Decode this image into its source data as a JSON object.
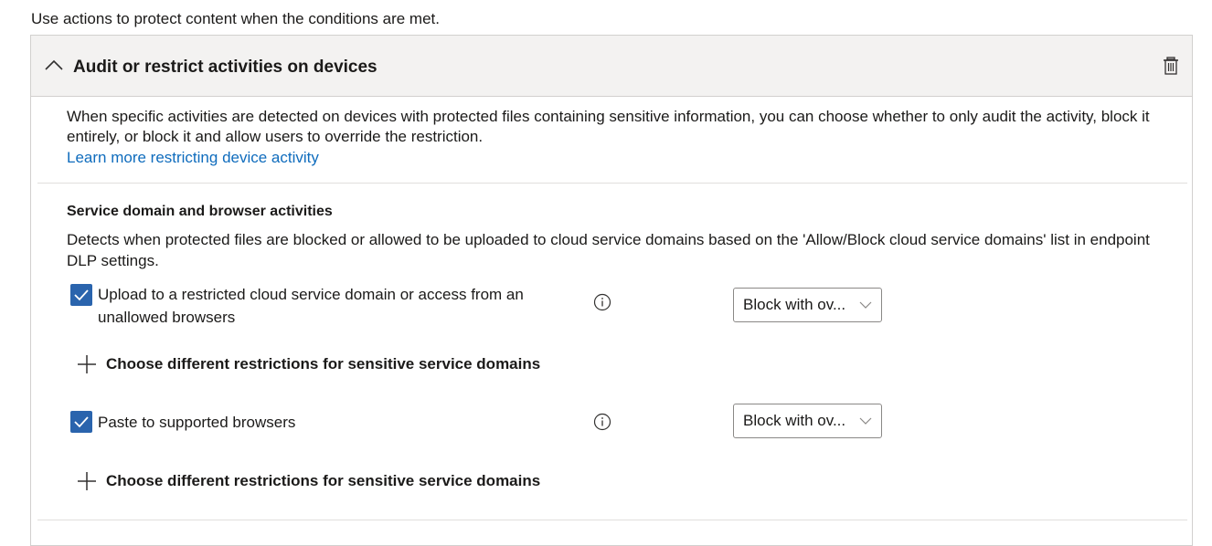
{
  "intro_text": "Use actions to protect content when the conditions are met.",
  "panel": {
    "title": "Audit or restrict activities on devices",
    "description": "When specific activities are detected on devices with protected files containing sensitive information, you can choose whether to only audit the activity, block it entirely, or block it and allow users to override the restriction.",
    "learn_more": "Learn more restricting device activity"
  },
  "section": {
    "title": "Service domain and browser activities",
    "description": "Detects when protected files are blocked or allowed to be uploaded to cloud service domains based on the 'Allow/Block cloud service domains' list in endpoint DLP settings.",
    "activities": [
      {
        "label": "Upload to a restricted cloud service domain or access from an unallowed browsers",
        "checked": true,
        "action": "Block with ov...",
        "add_link": "Choose different restrictions for sensitive service domains"
      },
      {
        "label": "Paste to supported browsers",
        "checked": true,
        "action": "Block with ov...",
        "add_link": "Choose different restrictions for sensitive service domains"
      }
    ]
  },
  "colors": {
    "accent": "#2a64ad",
    "link": "#0f6cbd",
    "header_bg": "#f3f2f1"
  }
}
